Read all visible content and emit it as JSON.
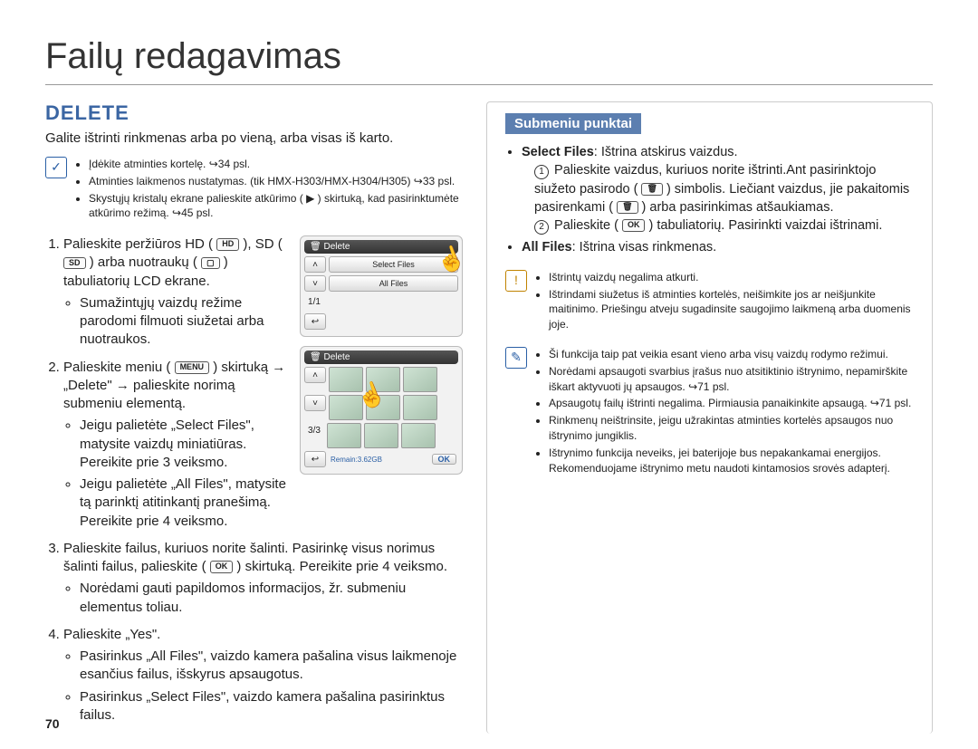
{
  "pageNumber": "70",
  "title": "Failų redagavimas",
  "section": "DELETE",
  "intro": "Galite ištrinti rinkmenas arba po vieną, arba visas iš karto.",
  "preNotes": [
    "Įdėkite atminties kortelę. ↪34 psl.",
    "Atminties laikmenos nustatymas. (tik HMX-H303/HMX-H304/H305) ↪33 psl.",
    "Skystųjų kristalų ekrane palieskite atkūrimo ( ▶ ) skirtuką, kad pasirinktumėte atkūrimo režimą. ↪45 psl."
  ],
  "steps": {
    "s1": "Palieskite peržiūros HD (",
    "s1b": "), SD (",
    "s1c": ") arba nuotraukų (",
    "s1d": ") tabuliatorių LCD ekrane.",
    "s1_bullet": "Sumažintųjų vaizdų režime parodomi filmuoti siužetai arba nuotraukos.",
    "s2a": "Palieskite meniu (",
    "s2b": ") skirtuką → „Delete\" → palieskite norimą submeniu elementą.",
    "s2_bullets": [
      "Jeigu palietėte „Select Files\", matysite vaizdų miniatiūras. Pereikite prie 3 veiksmo.",
      "Jeigu palietėte „All Files\", matysite tą parinktį atitinkantį pranešimą. Pereikite prie 4 veiksmo."
    ],
    "s3a": "Palieskite failus, kuriuos norite šalinti. Pasirinkę visus norimus šalinti failus, palieskite (",
    "s3b": ") skirtuką. Pereikite prie 4 veiksmo.",
    "s3_bullet": "Norėdami gauti papildomos informacijos, žr. submeniu elementus toliau.",
    "s4": "Palieskite „Yes\".",
    "s4_bullets": [
      "Pasirinkus „All Files\", vaizdo kamera pašalina visus laikmenoje esančius failus, išskyrus apsaugotus.",
      "Pasirinkus „Select Files\", vaizdo kamera pašalina pasirinktus failus."
    ]
  },
  "icons": {
    "hd": "HD",
    "sd": "SD",
    "photo": "▢",
    "menu": "MENU",
    "ok": "OK"
  },
  "shot1": {
    "title": "Delete",
    "opt1": "Select Files",
    "opt2": "All Files",
    "page": "1/1"
  },
  "shot2": {
    "title": "Delete",
    "page": "3/3",
    "remain": "Remain:3.62GB",
    "ok": "OK"
  },
  "subTab": "Submeniu punktai",
  "sub": {
    "sf_label": "Select Files",
    "sf_text": ": Ištrina atskirus vaizdus.",
    "sf_1a": "Palieskite vaizdus, kuriuos norite ištrinti.Ant pasirinktojo siužeto pasirodo (",
    "sf_1b": ") simbolis. Liečiant vaizdus, jie pakaitomis pasirenkami (",
    "sf_1c": ") arba pasirinkimas atšaukiamas.",
    "sf_2a": "Palieskite (",
    "sf_2b": ") tabuliatorių. Pasirinkti vaizdai ištrinami.",
    "af_label": "All Files",
    "af_text": ": Ištrina visas rinkmenas."
  },
  "warnNotes": [
    "Ištrintų vaizdų negalima atkurti.",
    "Ištrindami siužetus iš atminties kortelės, neišimkite jos ar neišjunkite maitinimo. Priešingu atveju sugadinsite saugojimo laikmeną arba duomenis joje."
  ],
  "infoNotes": [
    "Ši funkcija taip pat veikia esant vieno arba visų vaizdų rodymo režimui.",
    "Norėdami apsaugoti svarbius įrašus nuo atsitiktinio ištrynimo, nepamirškite iškart aktyvuoti jų apsaugos. ↪71 psl.",
    "Apsaugotų failų ištrinti negalima. Pirmiausia panaikinkite apsaugą. ↪71 psl.",
    "Rinkmenų neištrinsite, jeigu užrakintas atminties kortelės apsaugos nuo ištrynimo jungiklis.",
    "Ištrynimo funkcija neveiks, jei baterijoje bus nepakankamai energijos. Rekomenduojame ištrynimo metu naudoti kintamosios srovės adapterį."
  ]
}
